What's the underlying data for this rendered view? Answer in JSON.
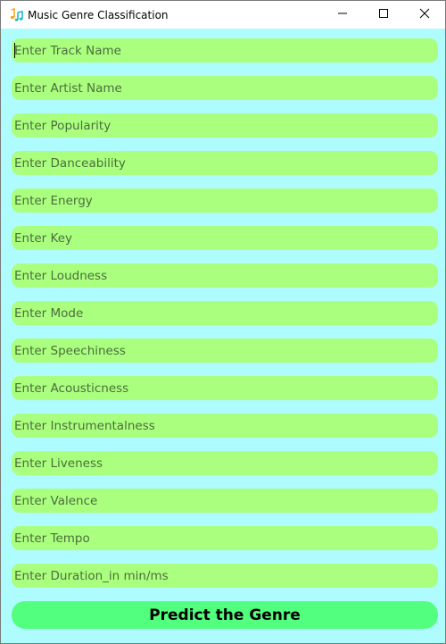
{
  "window": {
    "title": "Music Genre Classification",
    "app_icon": "music-note-icon",
    "controls": [
      "minimize-icon",
      "maximize-icon",
      "close-icon"
    ]
  },
  "colors": {
    "background": "#aefcfd",
    "field_fill": "#abff7f",
    "placeholder_text": "#4b6d3d",
    "button_fill": "#52ff7f"
  },
  "form": {
    "fields": [
      {
        "placeholder": "Enter Track Name"
      },
      {
        "placeholder": "Enter Artist Name"
      },
      {
        "placeholder": "Enter Popularity"
      },
      {
        "placeholder": "Enter Danceability"
      },
      {
        "placeholder": "Enter Energy"
      },
      {
        "placeholder": "Enter Key"
      },
      {
        "placeholder": "Enter Loudness"
      },
      {
        "placeholder": "Enter Mode"
      },
      {
        "placeholder": "Enter Speechiness"
      },
      {
        "placeholder": "Enter Acousticness"
      },
      {
        "placeholder": "Enter Instrumentalness"
      },
      {
        "placeholder": "Enter Liveness"
      },
      {
        "placeholder": "Enter Valence"
      },
      {
        "placeholder": "Enter Tempo"
      },
      {
        "placeholder": "Enter Duration_in min/ms"
      }
    ],
    "submit_label": "Predict the Genre"
  }
}
